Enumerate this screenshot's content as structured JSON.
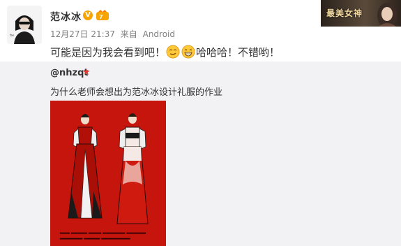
{
  "author": {
    "name": "范冰冰",
    "verified_badge": "V",
    "avatar_icon": "woman-portrait-avatar"
  },
  "meta": {
    "date": "12月27日 21:37",
    "source_prefix": "来自",
    "source": "Android"
  },
  "post": {
    "text_part1": "可能是因为我会看到吧！",
    "emojis": [
      "smirk-emoji",
      "grin-emoji"
    ],
    "text_part2": "哈哈哈！不错哟！"
  },
  "banner": {
    "label": "最美女神"
  },
  "repost": {
    "username": "@nhzqt",
    "star_icon": "star-icon",
    "text": "为什么老师会想出为范冰冰设计礼服的作业",
    "image_icon": "fashion-sketch-image"
  },
  "colors": {
    "sketch_background": "#c5150c",
    "repost_background": "#f2f2f5",
    "meta_text": "#808080",
    "star": "#e8392f"
  }
}
